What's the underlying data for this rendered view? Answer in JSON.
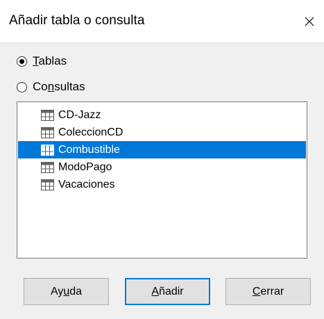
{
  "window": {
    "title": "Añadir tabla o consulta",
    "close_glyph": "×"
  },
  "source_options": [
    {
      "pre": "",
      "key": "T",
      "post": "ablas",
      "selected": true
    },
    {
      "pre": "Co",
      "key": "n",
      "post": "sultas",
      "selected": false
    }
  ],
  "tables": {
    "items": [
      {
        "label": "CD-Jazz",
        "icon": "table-icon",
        "selected": false
      },
      {
        "label": "ColeccionCD",
        "icon": "table-icon",
        "selected": false
      },
      {
        "label": "Combustible",
        "icon": "table-icon",
        "selected": true
      },
      {
        "label": "ModoPago",
        "icon": "table-icon",
        "selected": false
      },
      {
        "label": "Vacaciones",
        "icon": "table-icon",
        "selected": false
      }
    ]
  },
  "buttons": {
    "help": {
      "pre": "Ay",
      "key": "u",
      "post": "da"
    },
    "add": {
      "pre": "",
      "key": "A",
      "post": "ñadir"
    },
    "close": {
      "pre": "",
      "key": "C",
      "post": "errar"
    }
  },
  "colors": {
    "selection": "#0078d7",
    "selection_text": "#ffffff",
    "dialog_bg": "#f0f0f0",
    "button_bg": "#e1e1e1",
    "default_button_border": "#0078d7"
  }
}
